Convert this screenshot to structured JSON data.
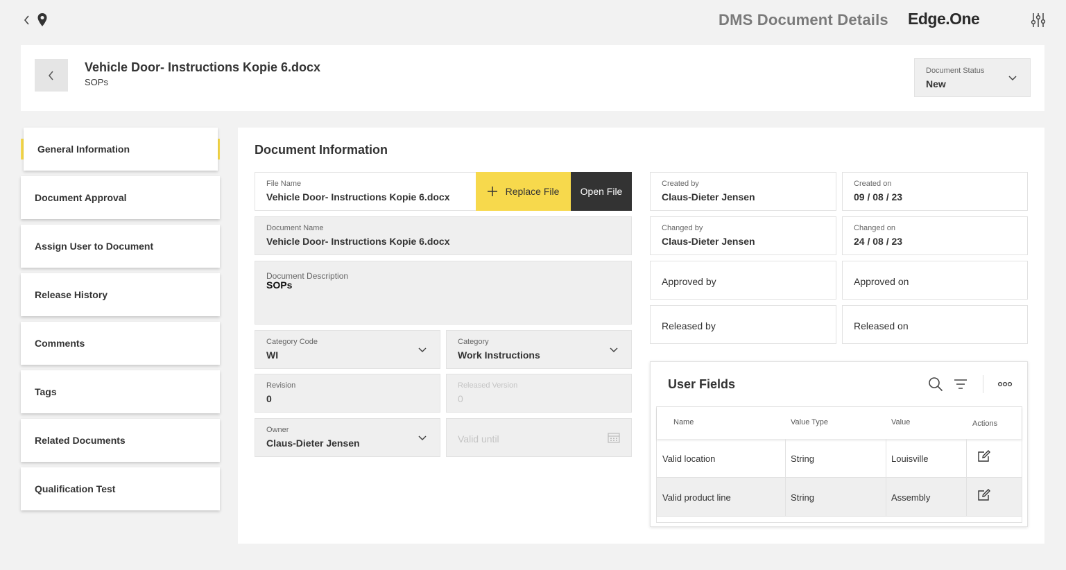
{
  "app": {
    "title": "DMS Document Details",
    "brand": "Edge.One"
  },
  "header": {
    "doc_title": "Vehicle Door- Instructions Kopie 6.docx",
    "doc_subtitle": "SOPs",
    "status_label": "Document Status",
    "status_value": "New"
  },
  "sidebar": {
    "items": [
      {
        "label": "General Information",
        "active": true
      },
      {
        "label": "Document Approval"
      },
      {
        "label": "Assign User to Document"
      },
      {
        "label": "Release History"
      },
      {
        "label": "Comments"
      },
      {
        "label": "Tags"
      },
      {
        "label": "Related Documents"
      },
      {
        "label": "Qualification Test"
      }
    ]
  },
  "info": {
    "section_title": "Document Information",
    "file_name_label": "File Name",
    "file_name_value": "Vehicle Door- Instructions Kopie 6.docx",
    "replace_file": "Replace File",
    "open_file": "Open File",
    "doc_name_label": "Document Name",
    "doc_name_value": "Vehicle Door- Instructions Kopie 6.docx",
    "desc_label": "Document Description",
    "desc_value": "SOPs",
    "cat_code_label": "Category Code",
    "cat_code_value": "WI",
    "category_label": "Category",
    "category_value": "Work Instructions",
    "revision_label": "Revision",
    "revision_value": "0",
    "released_version_label": "Released Version",
    "released_version_value": "0",
    "owner_label": "Owner",
    "owner_value": "Claus-Dieter Jensen",
    "valid_until_placeholder": "Valid until",
    "created_by_label": "Created by",
    "created_by_value": "Claus-Dieter Jensen",
    "created_on_label": "Created on",
    "created_on_value": "09 / 08 / 23",
    "changed_by_label": "Changed by",
    "changed_by_value": "Claus-Dieter Jensen",
    "changed_on_label": "Changed on",
    "changed_on_value": "24 / 08 / 23",
    "approved_by": "Approved by",
    "approved_on": "Approved on",
    "released_by": "Released by",
    "released_on": "Released on"
  },
  "user_fields": {
    "title": "User Fields",
    "columns": [
      "Name",
      "Value Type",
      "Value",
      "Actions"
    ],
    "rows": [
      {
        "name": "Valid location",
        "type": "String",
        "value": "Louisville"
      },
      {
        "name": "Valid product line",
        "type": "String",
        "value": "Assembly"
      }
    ]
  },
  "colors": {
    "accent": "#f7d94c",
    "dark": "#333333",
    "background": "#f2f2f2"
  }
}
